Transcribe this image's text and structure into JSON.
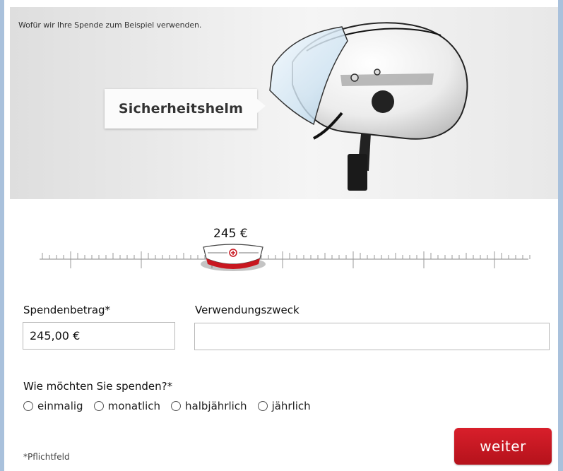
{
  "hero": {
    "caption": "Wofür wir Ihre Spende zum Beispiel verwenden.",
    "item_label": "Sicherheitshelm"
  },
  "slider": {
    "amount_display": "245 €",
    "value": 245
  },
  "form": {
    "amount_label": "Spendenbetrag*",
    "amount_value": "245,00 €",
    "purpose_label": "Verwendungszweck",
    "purpose_value": "",
    "frequency_label": "Wie möchten Sie spenden?*",
    "frequency_options": [
      "einmalig",
      "monatlich",
      "halbjährlich",
      "jährlich"
    ],
    "required_note": "*Pflichtfeld",
    "submit_label": "weiter"
  },
  "colors": {
    "accent": "#c8161f",
    "frame": "#a9c1dc"
  }
}
